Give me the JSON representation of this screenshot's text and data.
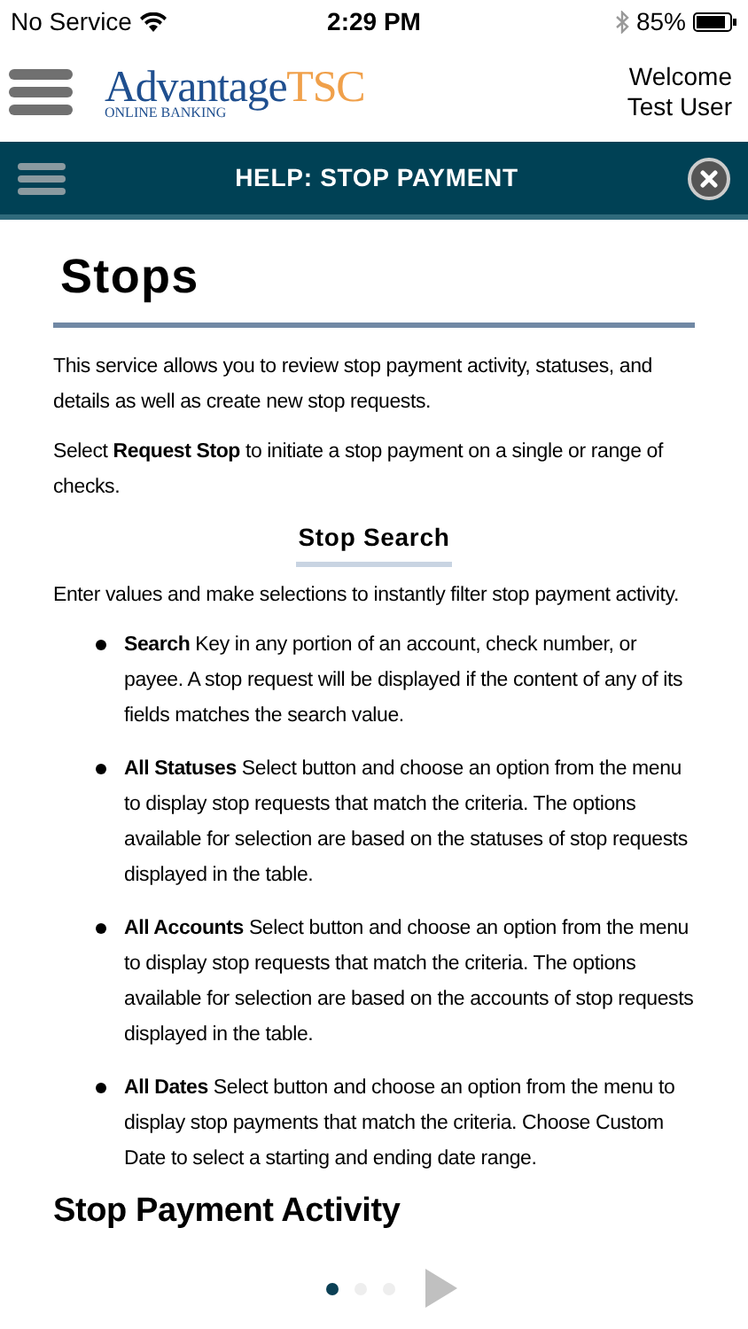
{
  "status_bar": {
    "carrier": "No Service",
    "time": "2:29 PM",
    "battery": "85%"
  },
  "header": {
    "logo_main": "Advantage",
    "logo_accent": "TSC",
    "logo_sub": "ONLINE BANKING",
    "welcome": "Welcome",
    "user": "Test User"
  },
  "help_bar": {
    "title": "HELP: STOP PAYMENT"
  },
  "content": {
    "title": "Stops",
    "paragraphs": [
      "This service allows you to review stop payment activity, statuses, and details as well as create new stop requests.",
      "Select **Request Stop** to initiate a stop payment on a single or range of checks."
    ],
    "section_title": "Stop Search",
    "section_intro": "Enter values and make selections to instantly filter stop payment activity.",
    "bullets": [
      "**Search** Key in any portion of an account, check number, or payee. A stop request will be displayed if the content of any of its fields matches the search value.",
      "**All Statuses** Select button and choose an option from the menu to display stop requests that match the criteria. The options available for selection are based on the statuses of stop requests displayed in the table.",
      "**All Accounts** Select button and choose an option from the menu to display stop requests that match the criteria. The options available for selection are based on the accounts of stop requests displayed in the table.",
      "**All Dates** Select button and choose an option from the menu to display stop payments that match the criteria. Choose Custom Date to select a starting and ending date range."
    ],
    "next_section_title": "Stop Payment Activity"
  },
  "pager": {
    "dots": [
      {
        "selected": true
      },
      {
        "selected": false
      },
      {
        "selected": false
      }
    ]
  }
}
